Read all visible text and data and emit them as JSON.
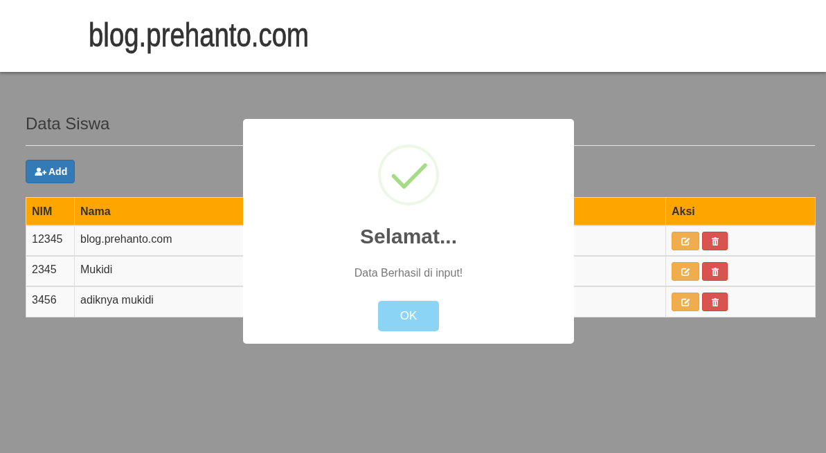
{
  "header": {
    "site_title": "blog.prehanto.com"
  },
  "page": {
    "title": "Data Siswa",
    "add_button": "Add"
  },
  "table": {
    "columns": [
      "NIM",
      "Nama",
      "Aksi"
    ],
    "rows": [
      {
        "nim": "12345",
        "nama": "blog.prehanto.com"
      },
      {
        "nim": "2345",
        "nama": "Mukidi"
      },
      {
        "nim": "3456",
        "nama": "adiknya mukidi"
      }
    ]
  },
  "dialog": {
    "kind": "success",
    "title": "Selamat...",
    "message": "Data Berhasil di input!",
    "button": "OK"
  }
}
